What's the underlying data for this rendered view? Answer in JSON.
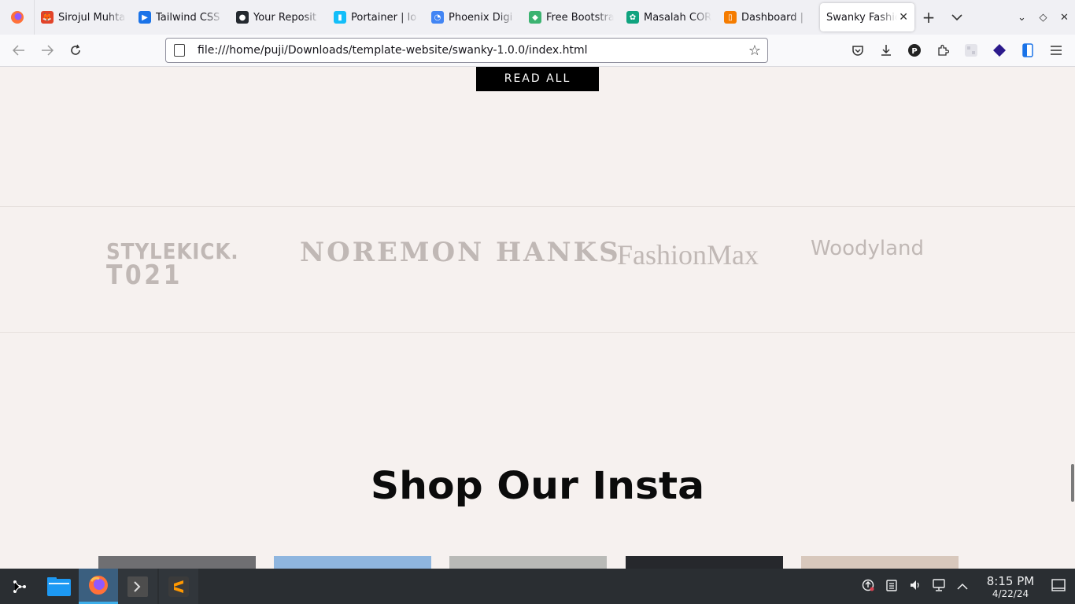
{
  "browser": {
    "tabs": [
      {
        "title": "Sirojul Muhta",
        "color": "#e24329",
        "glyph": "🦊"
      },
      {
        "title": "Tailwind CSS",
        "color": "#1a73e8",
        "glyph": "▶"
      },
      {
        "title": "Your Reposit",
        "color": "#24292f",
        "glyph": "●"
      },
      {
        "title": "Portainer | lo",
        "color": "#13bef9",
        "glyph": "▮"
      },
      {
        "title": "Phoenix Digi",
        "color": "#4285f4",
        "glyph": "◔"
      },
      {
        "title": "Free Bootstra",
        "color": "#3cb371",
        "glyph": "◆"
      },
      {
        "title": "Masalah COR",
        "color": "#10a37f",
        "glyph": "✿"
      },
      {
        "title": "Dashboard |",
        "color": "#f57c00",
        "glyph": "▯"
      }
    ],
    "active_tab": {
      "title": "Swanky Fashio",
      "close": "✕"
    },
    "new_tab": "+",
    "tab_list": "⌄",
    "url": "file:///home/puji/Downloads/template-website/swanky-1.0.0/index.html"
  },
  "page": {
    "read_all_label": "READ ALL",
    "brands": {
      "stylekick_line1": "STYLEKICK.",
      "stylekick_line2": "T021",
      "noremon": "NOREMON HANKS",
      "fashionmax": "FashionMax",
      "woodyland": "Woodyland"
    },
    "insta_title": "Shop Our Insta",
    "insta_colors": [
      "#6f6f72",
      "#8fb6df",
      "#b9bab7",
      "#26282c",
      "#d8c8bc"
    ]
  },
  "taskbar": {
    "time": "8:15 PM",
    "date": "4/22/24"
  }
}
